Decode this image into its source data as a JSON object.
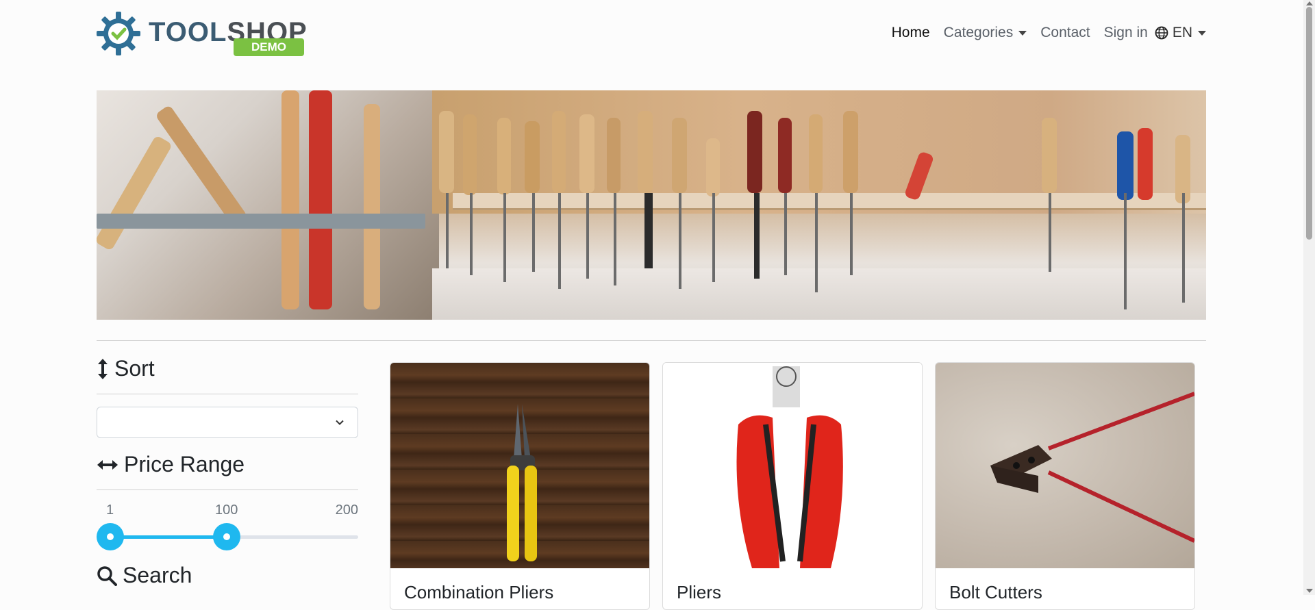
{
  "brand": {
    "name_part1": "TOOL",
    "name_part2": "SHOP",
    "badge": "DEMO"
  },
  "nav": {
    "home": "Home",
    "categories": "Categories",
    "contact": "Contact",
    "signin": "Sign in",
    "language": "EN"
  },
  "sidebar": {
    "sort_heading": "Sort",
    "sort_value": "",
    "price_heading": "Price Range",
    "price_min_label": "1",
    "price_value_label": "100",
    "price_max_label": "200",
    "price_range": {
      "min": 1,
      "max": 200,
      "selected_low": 1,
      "selected_high": 100
    },
    "search_heading": "Search"
  },
  "products": [
    {
      "name": "Combination Pliers"
    },
    {
      "name": "Pliers"
    },
    {
      "name": "Bolt Cutters"
    }
  ],
  "colors": {
    "accent": "#1fb8ef",
    "brand_green": "#7bc142",
    "brand_blue": "#3b5c73"
  }
}
